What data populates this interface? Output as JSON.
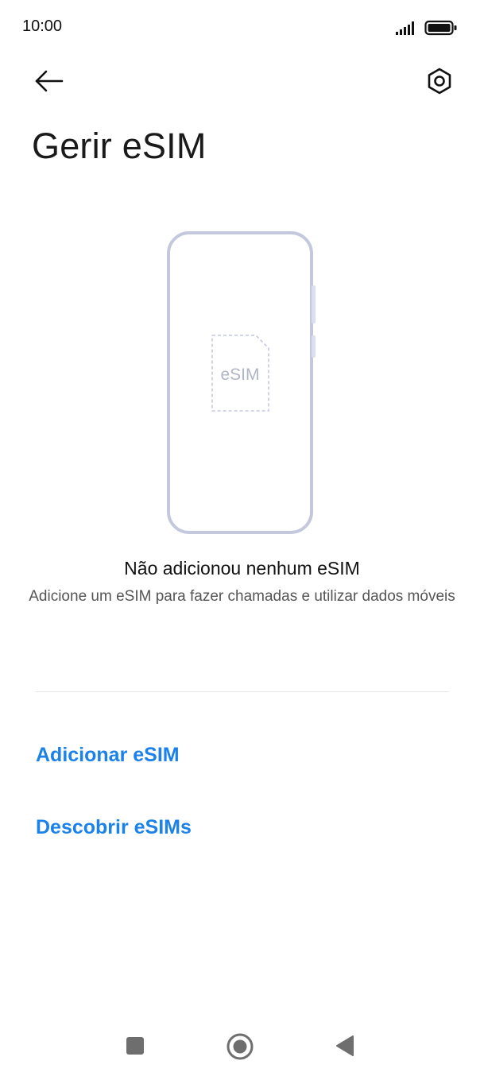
{
  "status_bar": {
    "time": "10:00",
    "signal_icon": "signal-icon",
    "battery_icon": "battery-icon"
  },
  "toolbar": {
    "back_icon": "arrow-left-icon",
    "settings_icon": "settings-hexagon-icon"
  },
  "page": {
    "title": "Gerir eSIM"
  },
  "illustration": {
    "sim_label": "eSIM",
    "icon": "phone-esim-icon"
  },
  "empty_state": {
    "title": "Não adicionou nenhum eSIM",
    "subtitle": "Adicione um eSIM para fazer chamadas e utilizar dados móveis"
  },
  "actions": {
    "add_esim": "Adicionar eSIM",
    "discover_esims": "Descobrir eSIMs"
  },
  "nav_bar": {
    "recent_icon": "square-icon",
    "home_icon": "circle-home-icon",
    "back_icon": "triangle-back-icon"
  },
  "colors": {
    "accent": "#1a82e8",
    "illustration_stroke": "#c4c8dc"
  }
}
